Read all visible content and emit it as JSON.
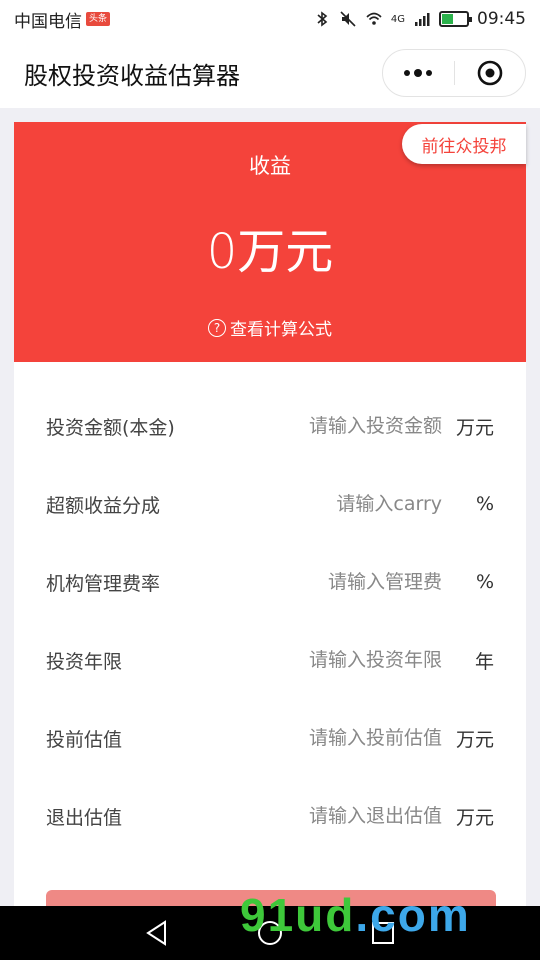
{
  "status_bar": {
    "carrier": "中国电信",
    "badge": "头条",
    "network": "4G",
    "time": "09:45",
    "battery_level": 0.45
  },
  "nav": {
    "title": "股权投资收益估算器"
  },
  "hero": {
    "label": "收益",
    "value": "0万元",
    "formula_link": "查看计算公式",
    "go_button": "前往众投邦"
  },
  "form": {
    "rows": [
      {
        "label": "投资金额(本金)",
        "placeholder": "请输入投资金额",
        "unit": "万元"
      },
      {
        "label": "超额收益分成",
        "placeholder": "请输入carry",
        "unit": "%"
      },
      {
        "label": "机构管理费率",
        "placeholder": "请输入管理费",
        "unit": "%"
      },
      {
        "label": "投资年限",
        "placeholder": "请输入投资年限",
        "unit": "年"
      },
      {
        "label": "投前估值",
        "placeholder": "请输入投前估值",
        "unit": "万元"
      },
      {
        "label": "退出估值",
        "placeholder": "请输入退出估值",
        "unit": "万元"
      }
    ]
  },
  "watermark": {
    "part1": "91ud",
    "part2": ".com"
  },
  "colors": {
    "primary_red": "#f4433b",
    "button_pink": "#ef8985"
  }
}
